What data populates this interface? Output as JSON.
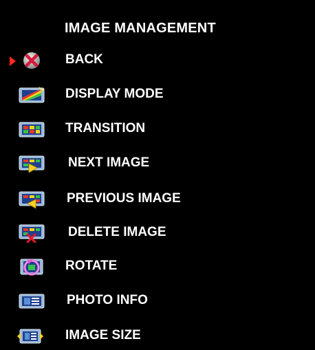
{
  "menu": {
    "title": "IMAGE MANAGEMENT",
    "selected_index": 0,
    "items": [
      {
        "label": "BACK",
        "icon": "back-x-icon",
        "selected": true
      },
      {
        "label": "DISPLAY MODE",
        "icon": "display-mode-icon",
        "selected": false
      },
      {
        "label": "TRANSITION",
        "icon": "transition-icon",
        "selected": false
      },
      {
        "label": "NEXT IMAGE",
        "icon": "next-image-icon",
        "selected": false
      },
      {
        "label": "PREVIOUS IMAGE",
        "icon": "previous-image-icon",
        "selected": false
      },
      {
        "label": "DELETE IMAGE",
        "icon": "delete-image-icon",
        "selected": false
      },
      {
        "label": "ROTATE",
        "icon": "rotate-icon",
        "selected": false
      },
      {
        "label": "PHOTO INFO",
        "icon": "photo-info-icon",
        "selected": false
      },
      {
        "label": "IMAGE SIZE",
        "icon": "image-size-icon",
        "selected": false
      }
    ]
  },
  "colors": {
    "background": "#000000",
    "text": "#ffffff",
    "pointer": "#ff2a1a",
    "icon_frame": "#7fa6c8",
    "icon_screen": "#1f3f8f"
  }
}
